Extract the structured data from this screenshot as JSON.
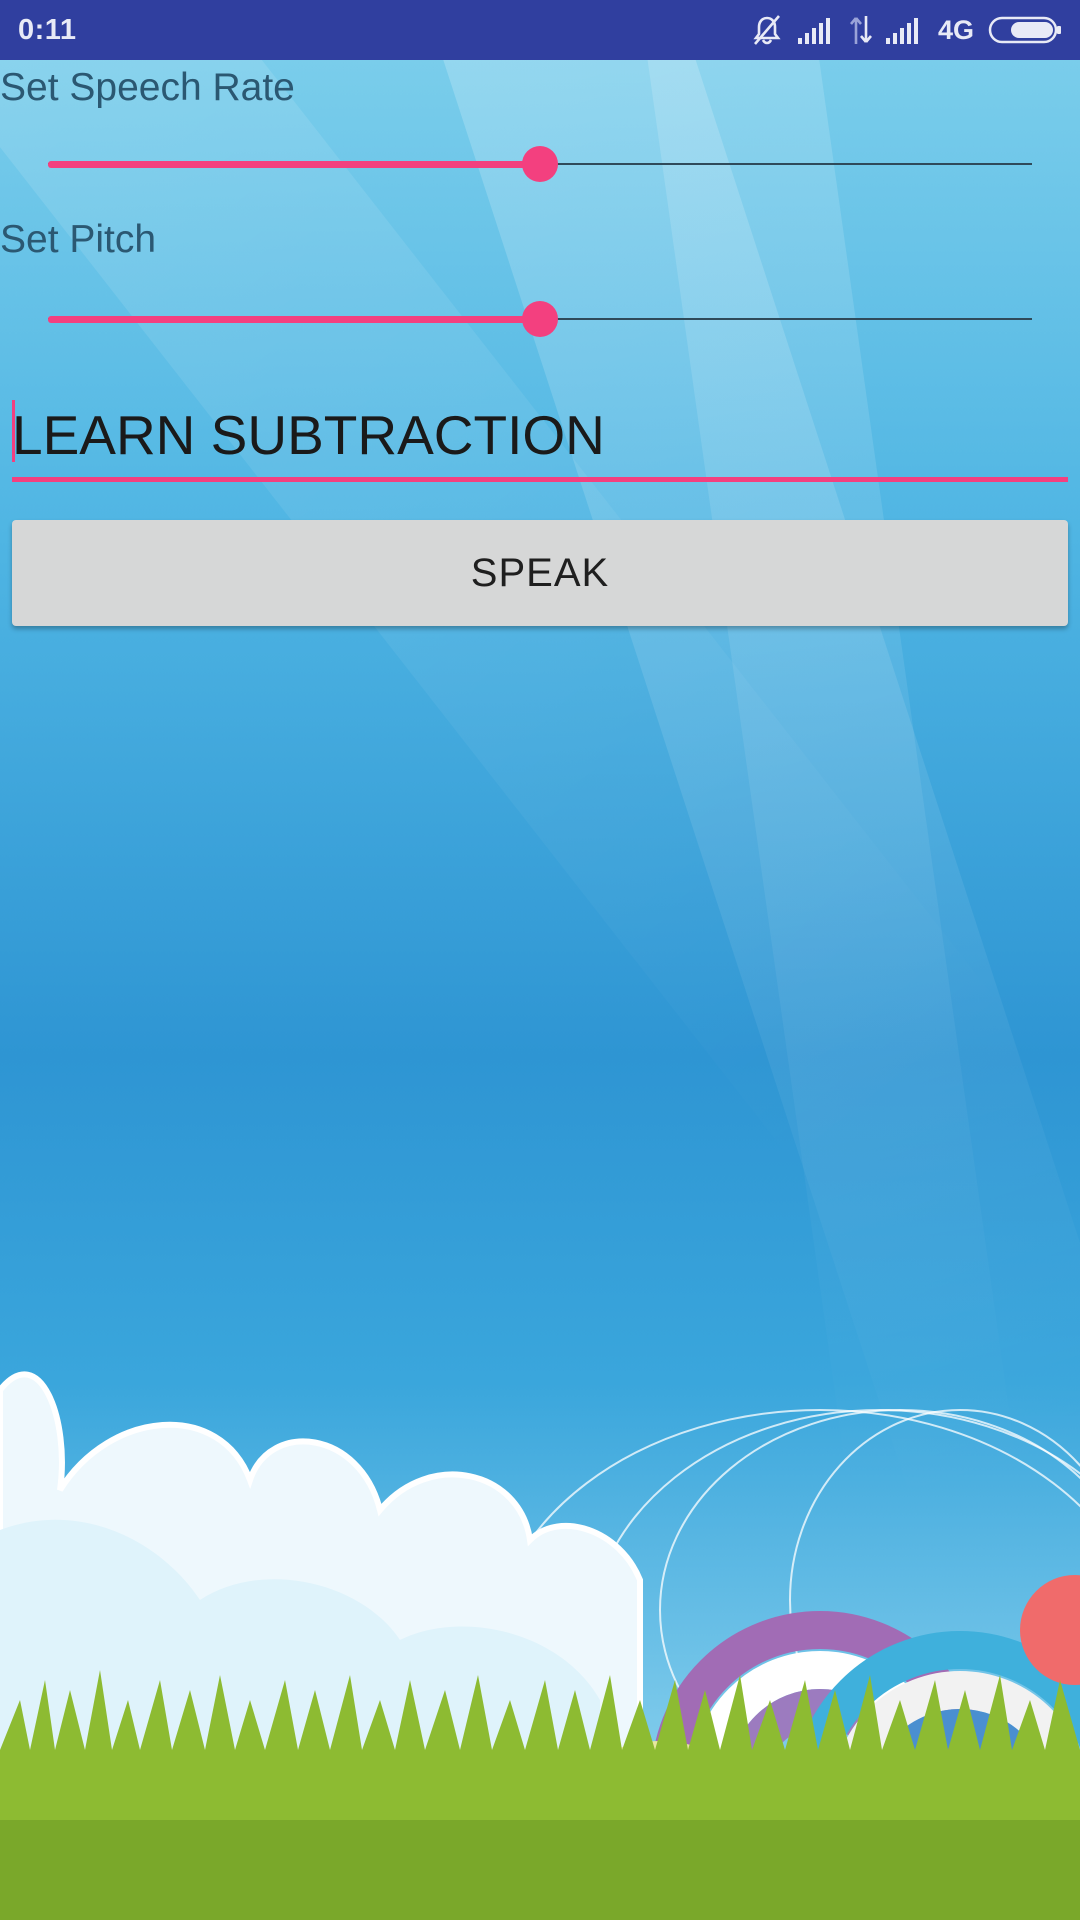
{
  "status_bar": {
    "time": "0:11",
    "network_type": "4G",
    "icons": [
      "notifications-off-icon",
      "signal-icon",
      "data-transfer-icon",
      "signal-icon",
      "battery-icon"
    ]
  },
  "speech_rate": {
    "label": "Set Speech Rate",
    "value_fraction": 0.5
  },
  "pitch": {
    "label": "Set Pitch",
    "value_fraction": 0.5
  },
  "text_input": {
    "value": "LEARN SUBTRACTION"
  },
  "speak_button": {
    "label": "SPEAK"
  },
  "colors": {
    "status_bar": "#303f9f",
    "accent": "#f3407f",
    "button": "#d6d7d7",
    "label_text": "#2b5872"
  }
}
